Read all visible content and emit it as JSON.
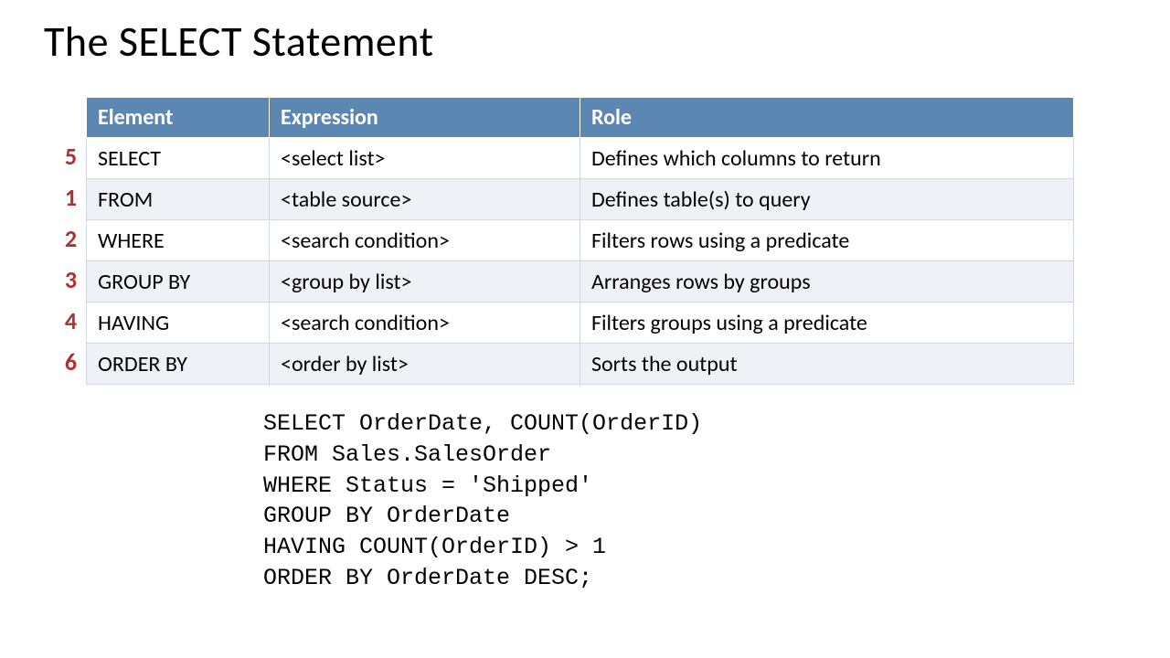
{
  "title": "The SELECT Statement",
  "headers": {
    "element": "Element",
    "expression": "Expression",
    "role": "Role"
  },
  "rows": [
    {
      "order": "5",
      "element": "SELECT",
      "expression": "<select list>",
      "role": "Defines which columns to return"
    },
    {
      "order": "1",
      "element": "FROM",
      "expression": "<table source>",
      "role": "Defines table(s) to query"
    },
    {
      "order": "2",
      "element": "WHERE",
      "expression": "<search condition>",
      "role": "Filters rows using a predicate"
    },
    {
      "order": "3",
      "element": "GROUP BY",
      "expression": "<group by list>",
      "role": "Arranges rows by groups"
    },
    {
      "order": "4",
      "element": "HAVING",
      "expression": "<search condition>",
      "role": "Filters groups using a predicate"
    },
    {
      "order": "6",
      "element": "ORDER BY",
      "expression": "<order by list>",
      "role": "Sorts the output"
    }
  ],
  "code": "SELECT OrderDate, COUNT(OrderID)\nFROM Sales.SalesOrder\nWHERE Status = 'Shipped'\nGROUP BY OrderDate\nHAVING COUNT(OrderID) > 1\nORDER BY OrderDate DESC;"
}
